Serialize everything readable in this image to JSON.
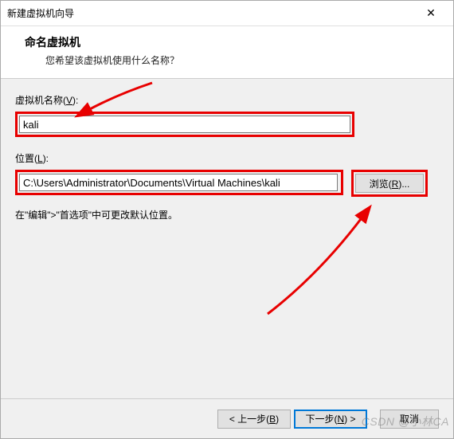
{
  "window": {
    "title": "新建虚拟机向导",
    "close": "✕"
  },
  "header": {
    "title": "命名虚拟机",
    "subtitle": "您希望该虚拟机使用什么名称？"
  },
  "form": {
    "name_label_pre": "虚拟机名称(",
    "name_label_key": "V",
    "name_label_post": "):",
    "name_value": "kali",
    "location_label_pre": "位置(",
    "location_label_key": "L",
    "location_label_post": "):",
    "location_value": "C:\\Users\\Administrator\\Documents\\Virtual Machines\\kali",
    "browse_label_pre": "浏览(",
    "browse_label_key": "R",
    "browse_label_post": ")...",
    "hint": "在\"编辑\">\"首选项\"中可更改默认位置。"
  },
  "footer": {
    "back_pre": "< 上一步(",
    "back_key": "B",
    "back_post": ")",
    "next_pre": "下一步(",
    "next_key": "N",
    "next_post": ") >",
    "cancel": "取消"
  },
  "watermark": "CSDN @小林CA"
}
